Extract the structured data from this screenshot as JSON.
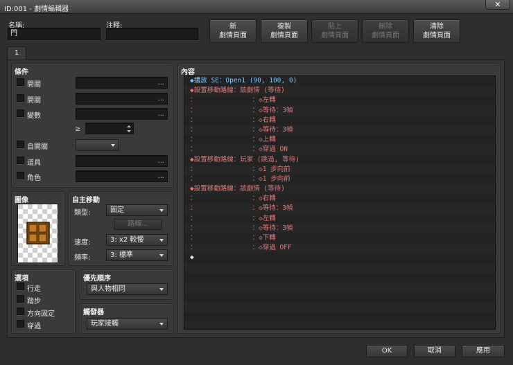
{
  "window": {
    "title": "ID:001 - 劇情編輯器",
    "close_glyph": "✕"
  },
  "name_field": {
    "label": "名稱:",
    "value": "門"
  },
  "note_field": {
    "label": "注釋:",
    "value": ""
  },
  "page_buttons": [
    {
      "line1": "新",
      "line2": "劇情頁面",
      "enabled": true
    },
    {
      "line1": "複製",
      "line2": "劇情頁面",
      "enabled": true
    },
    {
      "line1": "貼上",
      "line2": "劇情頁面",
      "enabled": false
    },
    {
      "line1": "刪除",
      "line2": "劇情頁面",
      "enabled": false
    },
    {
      "line1": "清除",
      "line2": "劇情頁面",
      "enabled": true
    }
  ],
  "tabs": [
    {
      "label": "1"
    }
  ],
  "conditions": {
    "title": "條件",
    "items": [
      {
        "label": "開關",
        "value": "",
        "button": "..."
      },
      {
        "label": "開關",
        "value": "",
        "button": "..."
      },
      {
        "label": "變數",
        "value": "",
        "button": "..."
      },
      {
        "label": "自開關",
        "value": ""
      },
      {
        "label": "道具",
        "value": "",
        "button": "..."
      },
      {
        "label": "角色",
        "value": "",
        "button": "..."
      }
    ],
    "ge_symbol": "≥",
    "var_value": ""
  },
  "image": {
    "title": "圖像"
  },
  "autonomous": {
    "title": "自主移動",
    "type_label": "類型:",
    "type_value": "固定",
    "route_button": "路線...",
    "speed_label": "速度:",
    "speed_value": "3: x2 較慢",
    "freq_label": "頻率:",
    "freq_value": "3: 標準"
  },
  "options": {
    "title": "選項",
    "items": [
      {
        "label": "行走"
      },
      {
        "label": "踏步"
      },
      {
        "label": "方向固定"
      },
      {
        "label": "穿過"
      }
    ]
  },
  "priority": {
    "title": "優先順序",
    "value": "與人物相同"
  },
  "trigger": {
    "title": "觸發器",
    "value": "玩家接觸"
  },
  "content": {
    "title": "內容",
    "lines": [
      {
        "text": "◆播放 SE：Open1 (90, 100, 0)",
        "type": "sound"
      },
      {
        "text": "◆設置移動路線：該劇情 (等待)",
        "type": "route"
      },
      {
        "text": "：              ：◇左轉",
        "type": "route"
      },
      {
        "text": "：              ：◇等待：3幀",
        "type": "route"
      },
      {
        "text": "：              ：◇右轉",
        "type": "route"
      },
      {
        "text": "：              ：◇等待：3幀",
        "type": "route"
      },
      {
        "text": "：              ：◇上轉",
        "type": "route"
      },
      {
        "text": "：              ：◇穿過 ON",
        "type": "route"
      },
      {
        "text": "◆設置移動路線：玩家 (跳過, 等待)",
        "type": "route"
      },
      {
        "text": "：              ：◇1 步向前",
        "type": "route"
      },
      {
        "text": "：              ：◇1 步向前",
        "type": "route"
      },
      {
        "text": "◆設置移動路線：該劇情 (等待)",
        "type": "route"
      },
      {
        "text": "：              ：◇右轉",
        "type": "route"
      },
      {
        "text": "：              ：◇等待：3幀",
        "type": "route"
      },
      {
        "text": "：              ：◇左轉",
        "type": "route"
      },
      {
        "text": "：              ：◇等待：3幀",
        "type": "route"
      },
      {
        "text": "：              ：◇下轉",
        "type": "route"
      },
      {
        "text": "：              ：◇穿過 OFF",
        "type": "route"
      },
      {
        "text": "◆",
        "type": "white"
      }
    ]
  },
  "footer": {
    "ok": "OK",
    "cancel": "取消",
    "apply": "應用"
  }
}
